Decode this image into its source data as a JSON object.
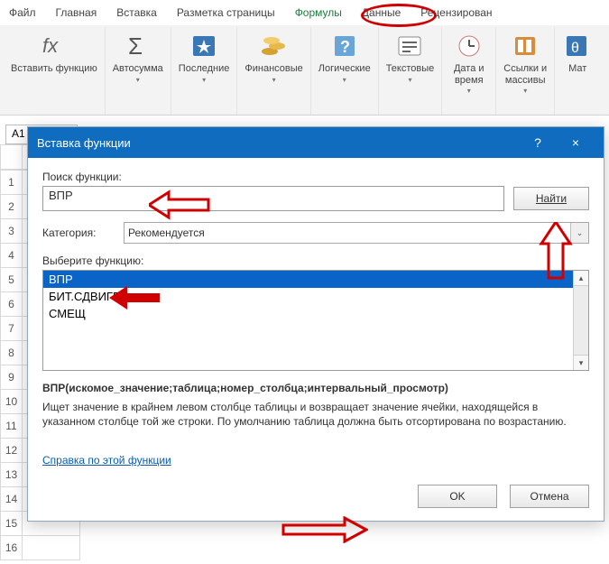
{
  "menu": {
    "tabs": [
      "Файл",
      "Главная",
      "Вставка",
      "Разметка страницы",
      "Формулы",
      "Данные",
      "Рецензирован"
    ],
    "active_index": 4
  },
  "ribbon": {
    "insert_fn": "Вставить функцию",
    "autosum": "Автосумма",
    "recent": "Последние",
    "financial": "Финансовые",
    "logical": "Логические",
    "text": "Текстовые",
    "datetime1": "Дата и",
    "datetime2": "время",
    "lookup1": "Ссылки и",
    "lookup2": "массивы",
    "math": "Мат"
  },
  "namebox": "A1",
  "dialog": {
    "title": "Вставка функции",
    "help_q": "?",
    "close_x": "×",
    "search_label": "Поиск функции:",
    "search_value": "ВПР",
    "find_btn": "Найти",
    "category_label": "Категория:",
    "category_value": "Рекомендуется",
    "select_label": "Выберите функцию:",
    "functions": [
      "ВПР",
      "БИТ.СДВИГП",
      "СМЕЩ"
    ],
    "syntax": "ВПР(искомое_значение;таблица;номер_столбца;интервальный_просмотр)",
    "description": "Ищет значение в крайнем левом столбце таблицы и возвращает значение ячейки, находящейся в указанном столбце той же строки. По умолчанию таблица должна быть отсортирована по возрастанию.",
    "help_link": "Справка по этой функции",
    "ok": "OK",
    "cancel": "Отмена"
  },
  "rows": [
    "1",
    "2",
    "3",
    "4",
    "5",
    "6",
    "7",
    "8",
    "9",
    "10",
    "11",
    "12",
    "13",
    "14",
    "15",
    "16"
  ]
}
